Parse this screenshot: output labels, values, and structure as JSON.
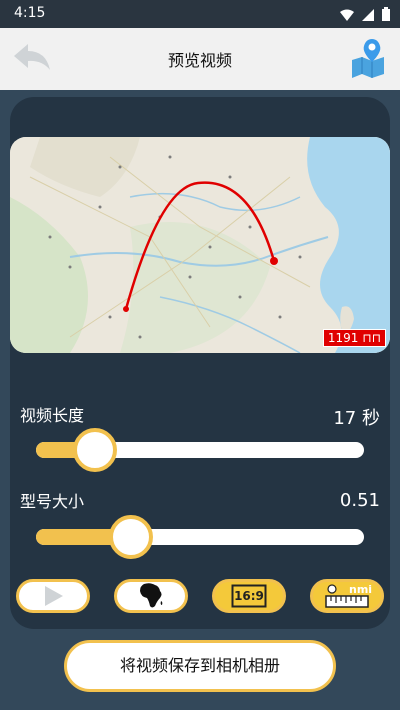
{
  "status_bar": {
    "time": "4:15",
    "icons": [
      "wifi-icon",
      "signal-icon",
      "battery-icon"
    ]
  },
  "nav": {
    "title": "预览视频",
    "back_icon": "back-arrow-icon",
    "map_icon": "map-pin-icon"
  },
  "map": {
    "distance_label": "1191 ⊓⊓"
  },
  "video_length": {
    "label": "视频长度",
    "value": "17 秒",
    "level": 0.18
  },
  "marker_size": {
    "label": "型号大小",
    "value": "0.51",
    "level": 0.29
  },
  "tools": [
    {
      "icon": "play-icon",
      "active": false
    },
    {
      "icon": "africa-map-icon",
      "active": false
    },
    {
      "icon": "aspect-ratio-icon",
      "label": "16:9",
      "active": true
    },
    {
      "icon": "unit-ruler-icon",
      "label": "nmi",
      "active": true
    }
  ],
  "save_button": {
    "label": "将视频保存到相机相册"
  },
  "colors": {
    "accent": "#f2c14e",
    "panel": "#243443",
    "route": "#e00000"
  }
}
